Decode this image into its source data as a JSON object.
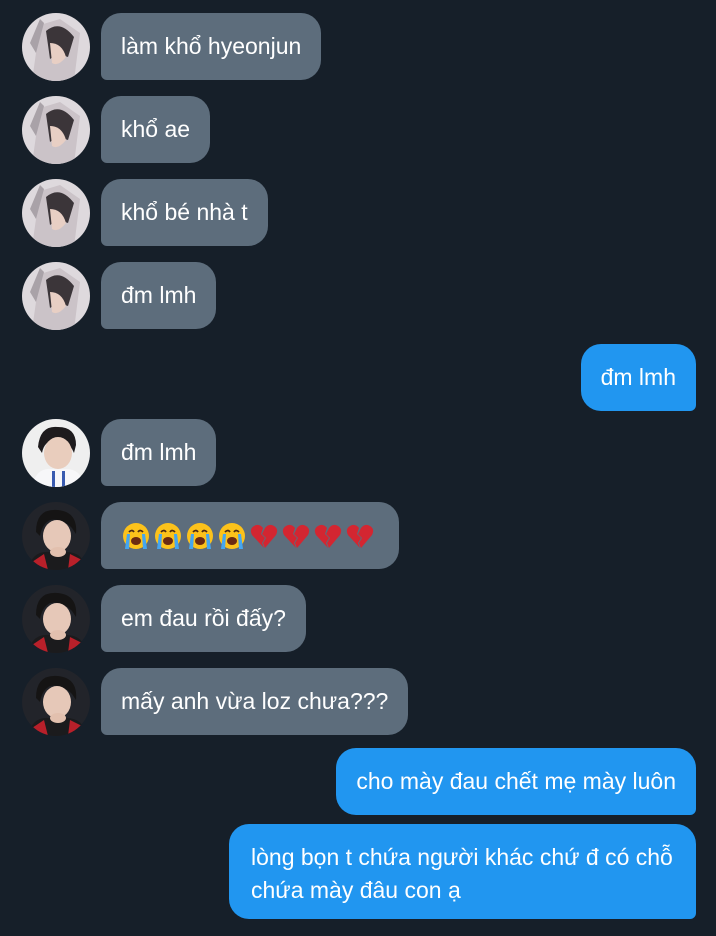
{
  "messages": [
    {
      "side": "in",
      "avatar": "avatar-a",
      "text": "làm khổ hyeonjun"
    },
    {
      "side": "in",
      "avatar": "avatar-a",
      "text": "khổ ae"
    },
    {
      "side": "in",
      "avatar": "avatar-a",
      "text": "khổ bé nhà t"
    },
    {
      "side": "in",
      "avatar": "avatar-a",
      "text": "đm lmh"
    },
    {
      "side": "out",
      "text": "đm lmh"
    },
    {
      "side": "in",
      "avatar": "avatar-b",
      "text": "đm lmh"
    },
    {
      "side": "in",
      "avatar": "avatar-c",
      "emojis": [
        "loudly-crying-face",
        "loudly-crying-face",
        "loudly-crying-face",
        "loudly-crying-face",
        "broken-heart",
        "broken-heart",
        "broken-heart",
        "broken-heart"
      ]
    },
    {
      "side": "in",
      "avatar": "avatar-c",
      "text": "em đau rồi đấy?"
    },
    {
      "side": "in",
      "avatar": "avatar-c",
      "text": "mấy anh vừa loz chưa???"
    },
    {
      "side": "out",
      "text": "cho mày đau chết mẹ mày luôn"
    },
    {
      "side": "out",
      "text": "lòng bọn t chứa người khác chứ đ có chỗ chứa mày đâu con ạ"
    }
  ],
  "colors": {
    "background": "#161f29",
    "incoming_bubble": "#5d6d7c",
    "outgoing_bubble": "#2196f0",
    "text": "#ffffff"
  }
}
